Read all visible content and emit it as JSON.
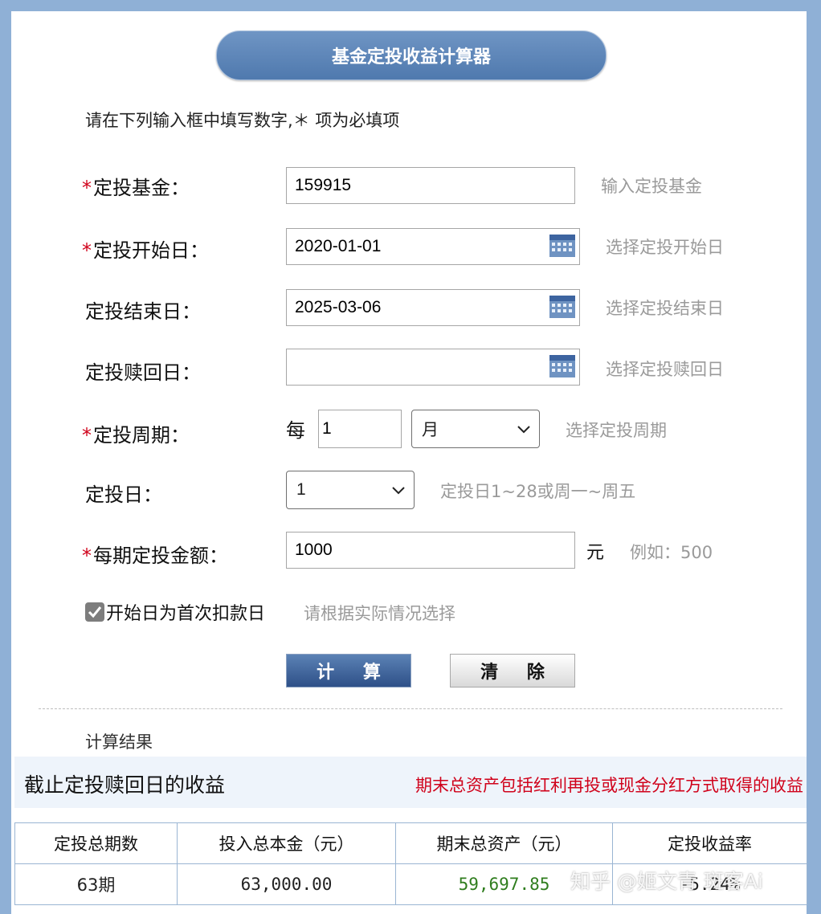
{
  "title": "基金定投收益计算器",
  "instruction": "请在下列输入框中填写数字,＊ 项为必填项",
  "required_mark": "*",
  "form": {
    "fund": {
      "label": "定投基金：",
      "required": true,
      "value": "159915",
      "hint": "输入定投基金"
    },
    "start_date": {
      "label": "定投开始日：",
      "required": true,
      "value": "2020-01-01",
      "hint": "选择定投开始日"
    },
    "end_date": {
      "label": "定投结束日：",
      "required": false,
      "value": "2025-03-06",
      "hint": "选择定投结束日"
    },
    "redeem_date": {
      "label": "定投赎回日：",
      "required": false,
      "value": "",
      "hint": "选择定投赎回日"
    },
    "period": {
      "label": "定投周期：",
      "required": true,
      "prefix": "每",
      "count": "1",
      "unit": "月",
      "hint": "选择定投周期"
    },
    "invest_day": {
      "label": "定投日：",
      "required": false,
      "value": "1",
      "hint": "定投日1~28或周一~周五"
    },
    "amount": {
      "label": "每期定投金额：",
      "required": true,
      "value": "1000",
      "unit": "元",
      "hint": "例如：500"
    },
    "first_deduct": {
      "label": "开始日为首次扣款日",
      "checked": true,
      "hint": "请根据实际情况选择"
    }
  },
  "buttons": {
    "calculate": "计 算",
    "clear": "清 除"
  },
  "results": {
    "section_label": "计算结果",
    "title": "截止定投赎回日的收益",
    "note": "期末总资产包括红利再投或现金分红方式取得的收益",
    "headers": [
      "定投总期数",
      "投入总本金（元）",
      "期末总资产（元）",
      "定投收益率"
    ],
    "row": [
      "63期",
      "63,000.00",
      "59,697.85",
      "-5.24%"
    ]
  },
  "watermark": "知乎 @姬文青 斑客Ai",
  "colors": {
    "required": "#d0021b",
    "title_bg": "#5a82b7",
    "positive_value": "#2f7d1e"
  },
  "icons": {
    "date_picker": "calendar-icon",
    "dropdown": "chevron-down-icon",
    "checkbox": "checkmark-icon"
  }
}
